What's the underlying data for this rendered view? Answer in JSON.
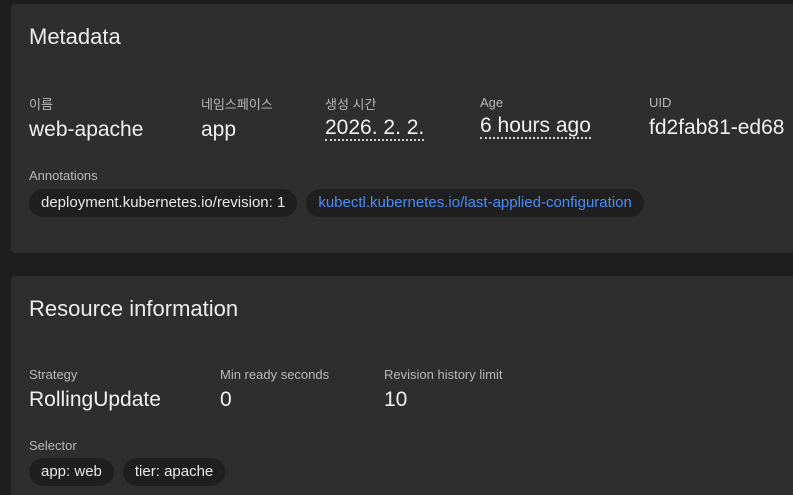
{
  "metadata": {
    "title": "Metadata",
    "fields": [
      {
        "label": "이름",
        "value": "web-apache"
      },
      {
        "label": "네임스페이스",
        "value": "app"
      },
      {
        "label": "생성 시간",
        "value": "2026. 2. 2."
      },
      {
        "label": "Age",
        "value": "6 hours ago"
      },
      {
        "label": "UID",
        "value": "fd2fab81-ed68"
      }
    ],
    "annotations_label": "Annotations",
    "annotations": [
      {
        "text": "deployment.kubernetes.io/revision: 1"
      },
      {
        "text": "kubectl.kubernetes.io/last-applied-configuration"
      }
    ]
  },
  "resource": {
    "title": "Resource information",
    "fields": [
      {
        "label": "Strategy",
        "value": "RollingUpdate"
      },
      {
        "label": "Min ready seconds",
        "value": "0"
      },
      {
        "label": "Revision history limit",
        "value": "10"
      }
    ],
    "selector_label": "Selector",
    "selector": [
      {
        "text": "app: web"
      },
      {
        "text": "tier: apache"
      }
    ]
  },
  "colors": {
    "background": "#1e1e1e",
    "card": "#2e2e2e",
    "chip": "#1f1f1f",
    "link": "#4a8cf7"
  }
}
